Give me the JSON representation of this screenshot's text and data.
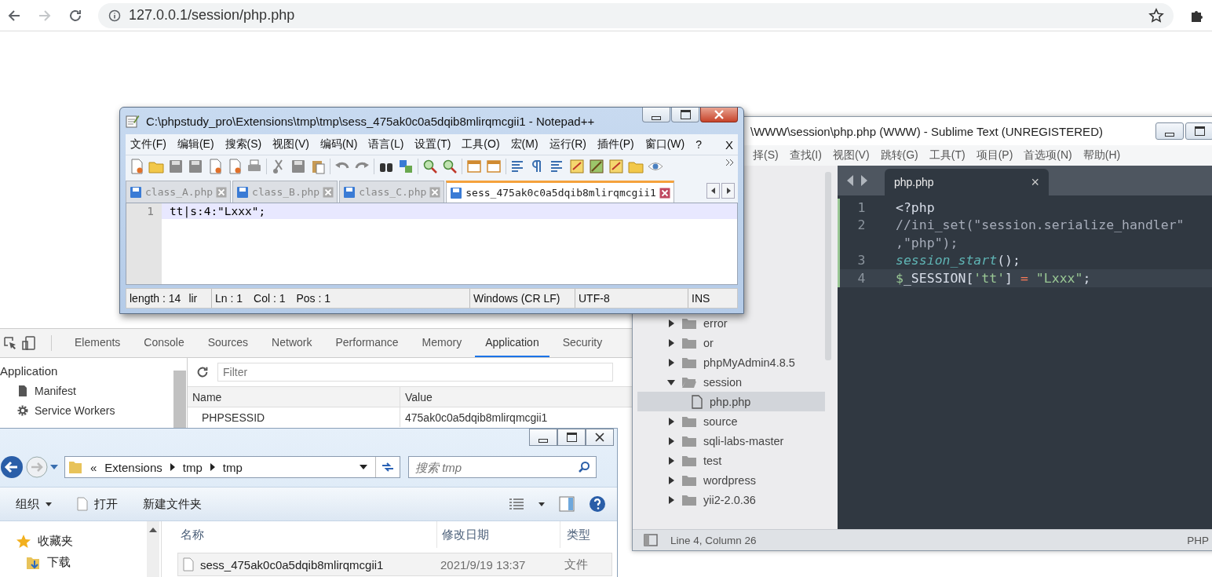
{
  "browser": {
    "back_disabled": false,
    "forward_disabled": true,
    "url": "127.0.0.1/session/php.php"
  },
  "devtools": {
    "tabs": [
      {
        "label": "Elements",
        "selected": false
      },
      {
        "label": "Console",
        "selected": false
      },
      {
        "label": "Sources",
        "selected": false
      },
      {
        "label": "Network",
        "selected": false
      },
      {
        "label": "Performance",
        "selected": false
      },
      {
        "label": "Memory",
        "selected": false
      },
      {
        "label": "Application",
        "selected": true
      },
      {
        "label": "Security",
        "selected": false
      }
    ],
    "sidebar": {
      "heading": "Application",
      "items": [
        {
          "label": "Manifest",
          "kind": "file",
          "selected": false
        },
        {
          "label": "Service Workers",
          "kind": "gear",
          "selected": false
        }
      ]
    },
    "filter": {
      "placeholder": "Filter"
    },
    "table": {
      "columns": [
        "Name",
        "Value"
      ],
      "rows": [
        [
          "PHPSESSID",
          "475ak0c0a5dqib8mlirqmcgii1"
        ]
      ]
    }
  },
  "sublime": {
    "title": "\\WWW\\session\\php.php (WWW) - Sublime Text (UNREGISTERED)",
    "menu": [
      "择(S)",
      "查找(I)",
      "视图(V)",
      "跳转(G)",
      "工具(T)",
      "项目(P)",
      "首选项(N)",
      "帮助(H)"
    ],
    "sidebar": [
      {
        "label": "error",
        "kind": "folder",
        "expanded": false,
        "selected": false
      },
      {
        "label": "or",
        "kind": "folder",
        "expanded": false,
        "selected": false
      },
      {
        "label": "phpMyAdmin4.8.5",
        "kind": "folder",
        "expanded": false,
        "selected": false
      },
      {
        "label": "session",
        "kind": "folder",
        "expanded": true,
        "selected": false,
        "children": [
          {
            "label": "php.php",
            "kind": "file",
            "selected": true
          }
        ]
      },
      {
        "label": "source",
        "kind": "folder",
        "expanded": false,
        "selected": false
      },
      {
        "label": "sqli-labs-master",
        "kind": "folder",
        "expanded": false,
        "selected": false
      },
      {
        "label": "test",
        "kind": "folder",
        "expanded": false,
        "selected": false
      },
      {
        "label": "wordpress",
        "kind": "folder",
        "expanded": false,
        "selected": false
      },
      {
        "label": "yii2-2.0.36",
        "kind": "folder",
        "expanded": false,
        "selected": false
      }
    ],
    "tab": {
      "label": "php.php",
      "close": "×"
    },
    "code": [
      {
        "number": "1",
        "current": false,
        "tokens": [
          {
            "text": "<?php",
            "kind": "plain"
          }
        ]
      },
      {
        "number": "2",
        "current": false,
        "tokens": [
          {
            "text": "//ini_set(\"session.serialize_handler\"",
            "kind": "comment"
          }
        ]
      },
      {
        "current": false,
        "tokens": [
          {
            "text": ",\"php\");",
            "kind": "comment"
          }
        ]
      },
      {
        "number": "3",
        "current": false,
        "tokens": [
          {
            "text": "session_start",
            "kind": "function"
          },
          {
            "text": "();",
            "kind": "plain"
          }
        ]
      },
      {
        "number": "4",
        "current": true,
        "tokens": [
          {
            "text": "$",
            "kind": "variable"
          },
          {
            "text": "_SESSION[",
            "kind": "plain"
          },
          {
            "text": "'tt'",
            "kind": "string"
          },
          {
            "text": "] ",
            "kind": "plain"
          },
          {
            "text": "= ",
            "kind": "operator"
          },
          {
            "text": "\"Lxxx\"",
            "kind": "string"
          },
          {
            "text": ";",
            "kind": "plain"
          }
        ]
      }
    ],
    "status": {
      "position": "Line 4, Column 26",
      "syntax": "PHP"
    }
  },
  "notepad": {
    "title": "C:\\phpstudy_pro\\Extensions\\tmp\\tmp\\sess_475ak0c0a5dqib8mlirqmcgii1 - Notepad++",
    "menu": [
      "文件(F)",
      "编辑(E)",
      "搜索(S)",
      "视图(V)",
      "编码(N)",
      "语言(L)",
      "设置(T)",
      "工具(O)",
      "宏(M)",
      "运行(R)",
      "插件(P)",
      "窗口(W)",
      "?"
    ],
    "menu_close": "X",
    "tabs": [
      {
        "label": "class_A.php",
        "selected": false
      },
      {
        "label": "class_B.php",
        "selected": false
      },
      {
        "label": "class_C.php",
        "selected": false
      },
      {
        "label": "sess_475ak0c0a5dqib8mlirqmcgii1",
        "selected": true
      }
    ],
    "lines": [
      {
        "number": "1",
        "text": "tt|s:4:\"Lxxx\";",
        "current": true
      }
    ],
    "status": [
      [
        "length : 14",
        "lir"
      ],
      [
        "Ln : 1",
        "Col : 1",
        "Pos : 1"
      ],
      [
        "Windows (CR LF)"
      ],
      [
        "UTF-8"
      ],
      [
        "INS"
      ]
    ]
  },
  "explorer": {
    "overflow_mark": "«",
    "breadcrumb": [
      "Extensions",
      "tmp",
      "tmp"
    ],
    "search": {
      "placeholder": "搜索 tmp"
    },
    "toolbar": [
      {
        "label": "组织",
        "kind": "dropdown"
      },
      {
        "label": "打开",
        "kind": "file"
      },
      {
        "label": "新建文件夹",
        "kind": "plain"
      }
    ],
    "nav": [
      {
        "label": "收藏夹",
        "kind": "star"
      },
      {
        "label": "下载",
        "kind": "download"
      }
    ],
    "columns": [
      "名称",
      "修改日期",
      "类型"
    ],
    "files": [
      {
        "name": "sess_475ak0c0a5dqib8mlirqmcgii1",
        "modified": "2021/9/19 13:37",
        "type": "文件"
      }
    ]
  }
}
